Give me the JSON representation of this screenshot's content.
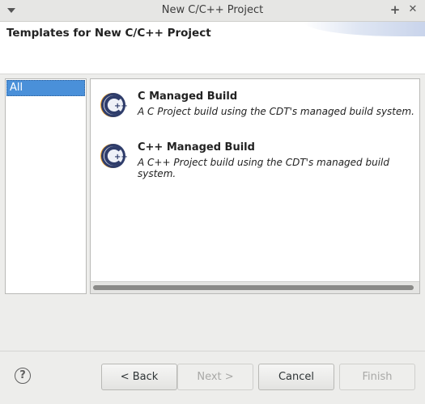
{
  "window": {
    "title": "New C/C++ Project",
    "controls": {
      "maximize": "+",
      "close": "✕"
    }
  },
  "header": {
    "title": "Templates for New C/C++ Project"
  },
  "categories": {
    "items": [
      {
        "label": "All",
        "selected": true
      }
    ]
  },
  "templates": [
    {
      "name": "C Managed Build",
      "description": "A C Project build using the CDT's managed build system.",
      "icon": "cdt-icon"
    },
    {
      "name": "C++ Managed Build",
      "description": "A C++ Project build using the CDT's managed build system.",
      "icon": "cdt-icon"
    }
  ],
  "buttons": {
    "help": "?",
    "back": "< Back",
    "next": "Next >",
    "cancel": "Cancel",
    "finish": "Finish"
  },
  "colors": {
    "selection": "#4a90d9",
    "icon_ring": "#3b4a7a",
    "icon_accent": "#f0a020"
  }
}
